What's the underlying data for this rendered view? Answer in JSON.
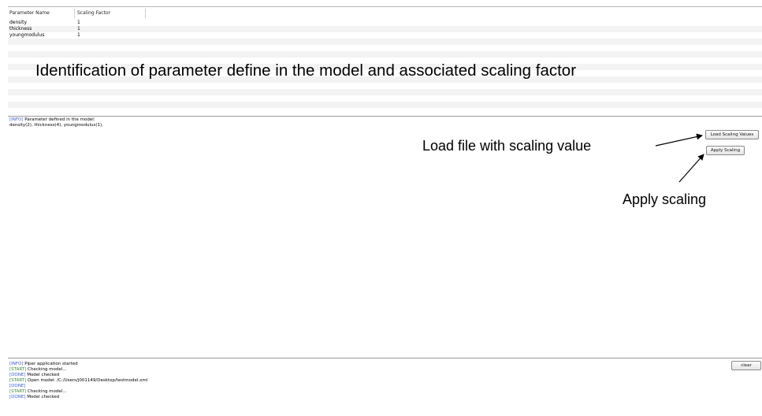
{
  "table": {
    "headers": [
      "Parameter Name",
      "Scaling Factor"
    ],
    "rows": [
      {
        "name": "density",
        "value": "1"
      },
      {
        "name": "thickness",
        "value": "1"
      },
      {
        "name": "youngmodulus",
        "value": "1"
      }
    ]
  },
  "annotations": {
    "table_caption": "Identification of parameter define in the model and associated scaling factor",
    "load_caption": "Load file with scaling value",
    "apply_caption": "Apply scaling"
  },
  "middle_log": {
    "line1_tag": "[INFO]",
    "line1_text": " Parameter defined in the model:",
    "line2_text": "density(2), thickness(4), youngmodulus(1),"
  },
  "buttons": {
    "load": "Load Scaling Values",
    "apply": "Apply Scaling",
    "clear": "clear"
  },
  "bottom_log": [
    {
      "tag": "[INFO]",
      "text": " Piper application started"
    },
    {
      "tag": "[START]",
      "text": " Checking model..."
    },
    {
      "tag": "[DONE]",
      "text": " Model checked"
    },
    {
      "tag": "[START]",
      "text": " Open model: /C:/Users/j001149/Desktop/testmodel.xml"
    },
    {
      "tag": "[DONE]",
      "text": ""
    },
    {
      "tag": "[START]",
      "text": " Checking model..."
    },
    {
      "tag": "[DONE]",
      "text": " Model checked"
    }
  ]
}
